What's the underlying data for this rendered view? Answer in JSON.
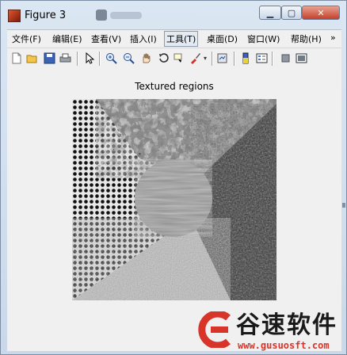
{
  "window": {
    "title": "Figure 3"
  },
  "controls": {
    "minimize": "▁",
    "maximize": "▢",
    "close": "✕"
  },
  "menu": [
    {
      "label": "文件(F)"
    },
    {
      "label": "编辑(E)"
    },
    {
      "label": "查看(V)"
    },
    {
      "label": "插入(I)"
    },
    {
      "label": "工具(T)"
    },
    {
      "label": "桌面(D)"
    },
    {
      "label": "窗口(W)"
    },
    {
      "label": "帮助(H)"
    }
  ],
  "menu_overflow": "»",
  "toolbar_icons": [
    "new-figure-icon",
    "open-file-icon",
    "save-icon",
    "print-icon",
    "edit-plot-arrow-icon",
    "zoom-in-icon",
    "zoom-out-icon",
    "pan-hand-icon",
    "rotate-3d-icon",
    "data-cursor-icon",
    "brush-icon",
    "link-plot-icon",
    "colorbar-icon",
    "legend-icon",
    "hide-plot-tools-icon",
    "show-plot-tools-icon"
  ],
  "figure": {
    "title": "Textured regions"
  },
  "watermark": {
    "brand": "谷速软件",
    "url": "www.gusuosft.com"
  }
}
